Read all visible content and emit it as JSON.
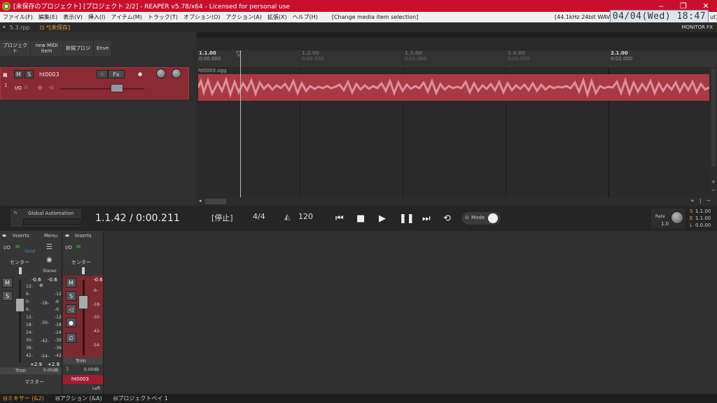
{
  "window": {
    "title": "[未保存のプロジェクト] [プロジェクト 2/2] - REAPER v5.78/x64 - Licensed for personal use",
    "minimize": "‒",
    "maximize": "❐",
    "close": "✕"
  },
  "menu": {
    "items": [
      "ファイル(F)",
      "編集(E)",
      "表示(V)",
      "挿入(I)",
      "アイテム(M)",
      "トラック(T)",
      "オプション(O)",
      "アクション(A)",
      "拡張(X)",
      "ヘルプ(H)"
    ],
    "selection_status": "[Change media item selection]",
    "format": "[44.1kHz 24bit WAV",
    "format_tail": "ut]"
  },
  "clock": "04/04(Wed)  18:47",
  "project_tabs": {
    "tab1": "5.3.rpp",
    "tab2": "*[未保存]",
    "monitor_fx": "MONITOR FX"
  },
  "tcp": {
    "buttons": [
      "プロジェクト",
      "new MIDI item",
      "新規プロジ",
      "Enve"
    ],
    "track": {
      "name": "ht0003",
      "number": "1",
      "mute": "M",
      "solo": "S",
      "fx": "Fx",
      "io": "I/O"
    }
  },
  "timeline": {
    "markers": [
      {
        "bar": "1.1.00",
        "time": "0:00.000"
      },
      {
        "bar": "1.2.00",
        "time": "0:00.500"
      },
      {
        "bar": "1.3.00",
        "time": "0:01.000"
      },
      {
        "bar": "1.4.00",
        "time": "0:01.500"
      },
      {
        "bar": "2.1.00",
        "time": "0:02.000"
      }
    ]
  },
  "item": {
    "name": "ht0003.ogg"
  },
  "transport": {
    "global_automation": "Global Automation",
    "position": "1.1.42 / 0:00.211",
    "state": "[停止]",
    "time_sig": "4/4",
    "bpm": "120",
    "mode": "Mode",
    "rate_label": "Rate",
    "rate_value": "1.0",
    "sel_start_label": "S",
    "sel_start": "1.1.00",
    "sel_end_label": "E",
    "sel_end": "1.1.00",
    "sel_len_label": "L",
    "sel_len": "0.0.00"
  },
  "mixer": {
    "master": {
      "inserts": "Inserts",
      "menu": "Menu",
      "io": "I/O",
      "m": "M",
      "send": "Send",
      "pan": "センター",
      "stereo": "Stereo",
      "peak_l": "-0.6",
      "peak_r": "-0.6",
      "mute": "M",
      "solo": "S",
      "scale": [
        "12-",
        "6-",
        "0-",
        "6-",
        "12-",
        "18-",
        "24-",
        "30-",
        "36-",
        "42-"
      ],
      "scale2": [
        "-12",
        "-6",
        "-6",
        "-12",
        "-18",
        "-24",
        "-30",
        "-36",
        "-42"
      ],
      "mid_scale": [
        "-18-",
        "-30-",
        "-42-",
        "-54-"
      ],
      "gain_l": "+2.9",
      "gain_r": "+2.9",
      "trim": "Trim",
      "trim_value": "0.00dB",
      "name": "マスター"
    },
    "track": {
      "inserts": "Inserts",
      "io": "I/O",
      "m": "M",
      "pan": "センター",
      "peak": "-0.6",
      "mute": "M",
      "solo": "S",
      "scale": [
        "-6-",
        "-18-",
        "-30-",
        "-42-",
        "-54-"
      ],
      "trim": "Trim",
      "number": "1",
      "trim_value": "0.00dB",
      "name": "ht0003",
      "channel": "Left"
    }
  },
  "bottom_tabs": [
    "ミキサー (&2)",
    "アクション (&A)",
    "プロジェクトベイ 1"
  ],
  "colors": {
    "title_bar": "#c8102e",
    "track": "#8a2a32",
    "item": "#a83a44",
    "waveform": "#e8a0a8",
    "accent_tab": "#e0a030"
  }
}
